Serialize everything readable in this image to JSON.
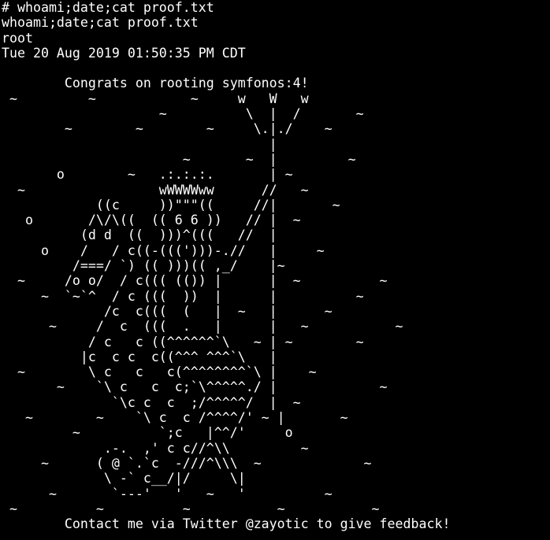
{
  "theme": {
    "background": "#000000",
    "foreground": "#ffffff"
  },
  "terminal": {
    "lines": [
      "# whoami;date;cat proof.txt",
      "whoami;date;cat proof.txt",
      "root",
      "Tue 20 Aug 2019 01:50:35 PM CDT",
      "",
      "        Congrats on rooting symfonos:4!",
      " ~         ~            ~     w   W   w",
      "                    ~          \\  |  /       ~",
      "        ~        ~        ~     \\.|./    ~",
      "                                  |",
      "                       ~       ~  |         ~",
      "       o        ~   .:.:.:.       | ~",
      "  ~                 wWWWWww      //   ~",
      "            ((c     ))\"\"\"((     //|       ~",
      "   o       /\\/\\((  (( 6 6 ))   // |  ~",
      "          (d d  ((  )))^(((   //  |",
      "     o    /   / c((-(((')))-.//   |     ~",
      "         /===/ `) (( )))(( ,_/    |~",
      "  ~     /o o/  / c((( (()) |      |  ~          ~",
      "     ~  `~`^  / c (((  ))  |      |          ~",
      "             /c  c(((  (   |  ~   |      ~",
      "      ~     /  c  (((  .   |      |   ~           ~",
      "           / c   c ((^^^^^^`\\   ~ | ~        ~",
      "          |c  c c  c((^^^ ^^^`\\   |",
      "  ~        \\ c   c   c(^^^^^^^^`\\ |    ~",
      "       ~    `\\ c   c  c;`\\^^^^^./ |             ~",
      "              `\\c c  c  ;/^^^^^/  |  ~",
      "   ~        ~    `\\ c  c /^^^^/' ~ |       ~",
      "         ~          `;c   |^^/'     o",
      "             .-.  ,' c c//^\\\\         ~",
      "     ~      ( @ `.`c  -///^\\\\\\  ~             ~",
      "             \\ -` c__/|/     \\|",
      "      ~       `---'   '   ~   '          ~",
      " ~          ~          ~           ~           ~",
      "        Contact me via Twitter @zayotic to give feedback!"
    ]
  }
}
